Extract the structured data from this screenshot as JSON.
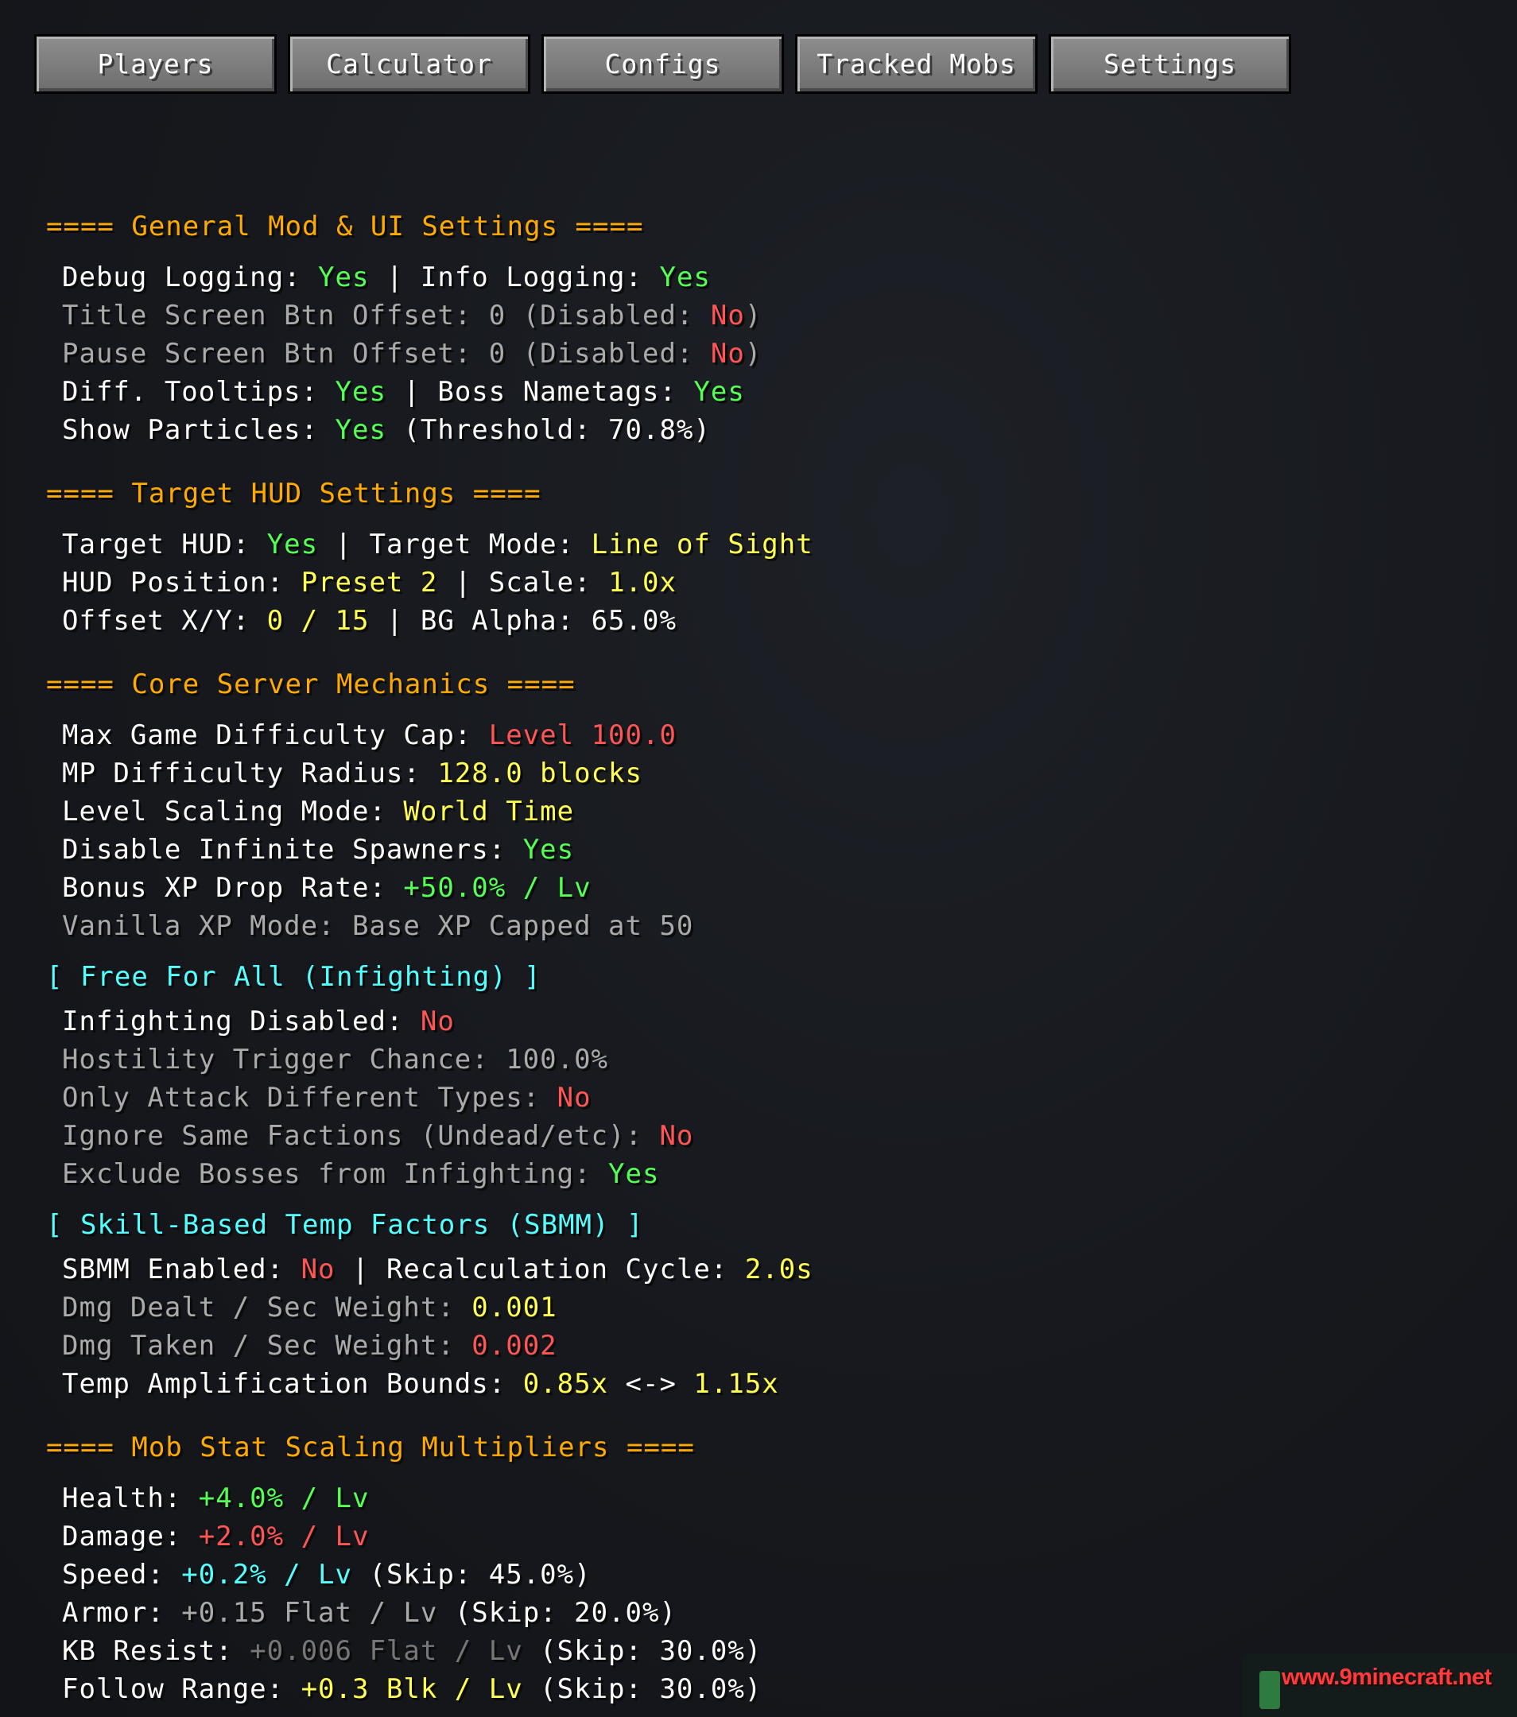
{
  "tabs": [
    "Players",
    "Calculator",
    "Configs",
    "Tracked Mobs",
    "Settings"
  ],
  "sections": {
    "general": {
      "title": "==== General Mod & UI Settings ====",
      "debug_label": "Debug Logging: ",
      "debug_value": "Yes",
      "sep1": " | ",
      "info_label": "Info Logging: ",
      "info_value": "Yes",
      "title_offset_label": "Title Screen Btn Offset: 0 (Disabled: ",
      "title_offset_value": "No",
      "title_offset_close": ")",
      "pause_offset_label": "Pause Screen Btn Offset: 0 (Disabled: ",
      "pause_offset_value": "No",
      "pause_offset_close": ")",
      "diff_tooltips_label": "Diff. Tooltips: ",
      "diff_tooltips_value": "Yes",
      "sep2": " | ",
      "boss_nametags_label": "Boss Nametags: ",
      "boss_nametags_value": "Yes",
      "particles_label": "Show Particles: ",
      "particles_value": "Yes",
      "particles_threshold": " (Threshold: 70.8%)"
    },
    "hud": {
      "title": "==== Target HUD Settings ====",
      "target_hud_label": "Target HUD: ",
      "target_hud_value": "Yes",
      "sep1": " | ",
      "target_mode_label": "Target Mode: ",
      "target_mode_value": "Line of Sight",
      "position_label": "HUD Position: ",
      "position_value": "Preset 2",
      "sep2": " | ",
      "scale_label": "Scale: ",
      "scale_value": "1.0x",
      "offset_label": "Offset X/Y: ",
      "offset_value": "0 / 15",
      "sep3": " | ",
      "bg_alpha": "BG Alpha: 65.0%"
    },
    "core": {
      "title": "==== Core Server Mechanics ====",
      "max_cap_label": "Max Game Difficulty Cap: ",
      "max_cap_value": "Level 100.0",
      "mp_radius_label": "MP Difficulty Radius: ",
      "mp_radius_value": "128.0 blocks",
      "scaling_mode_label": "Level Scaling Mode: ",
      "scaling_mode_value": "World Time",
      "spawners_label": "Disable Infinite Spawners: ",
      "spawners_value": "Yes",
      "bonus_xp_label": "Bonus XP Drop Rate: ",
      "bonus_xp_value": "+50.0% / Lv",
      "vanilla_xp": "Vanilla XP Mode: Base XP Capped at 50"
    },
    "ffa": {
      "title": "[ Free For All (Infighting) ]",
      "disabled_label": "Infighting Disabled: ",
      "disabled_value": "No",
      "hostility": "Hostility Trigger Chance: 100.0%",
      "diff_types_label": "Only Attack Different Types: ",
      "diff_types_value": "No",
      "factions_label": "Ignore Same Factions (Undead/etc): ",
      "factions_value": "No",
      "exclude_bosses_label": "Exclude Bosses from Infighting: ",
      "exclude_bosses_value": "Yes"
    },
    "sbmm": {
      "title": "[ Skill-Based Temp Factors (SBMM) ]",
      "enabled_label": "SBMM Enabled: ",
      "enabled_value": "No",
      "sep1": " | ",
      "recalc_label": "Recalculation Cycle: ",
      "recalc_value": "2.0s",
      "dealt_label": "Dmg Dealt / Sec Weight: ",
      "dealt_value": "0.001",
      "taken_label": "Dmg Taken / Sec Weight: ",
      "taken_value": "0.002",
      "bounds_label": "Temp Amplification Bounds: ",
      "bounds_low": "0.85x",
      "bounds_mid": " <-> ",
      "bounds_high": "1.15x"
    },
    "mob": {
      "title": "==== Mob Stat Scaling Multipliers ====",
      "health_label": "Health: ",
      "health_value": "+4.0% / Lv",
      "damage_label": "Damage: ",
      "damage_value": "+2.0% / Lv",
      "speed_label": "Speed: ",
      "speed_value": "+0.2% / Lv",
      "speed_skip": " (Skip: 45.0%)",
      "armor_label": "Armor: ",
      "armor_value": "+0.15 Flat / Lv",
      "armor_skip": " (Skip: 20.0%)",
      "kb_label": "KB Resist: ",
      "kb_value": "+0.006 Flat / Lv",
      "kb_skip": " (Skip: 30.0%)",
      "follow_label": "Follow Range: ",
      "follow_value": "+0.3 Blk / Lv",
      "follow_skip": " (Skip: 30.0%)"
    }
  },
  "watermark": "www.9minecraft.net"
}
